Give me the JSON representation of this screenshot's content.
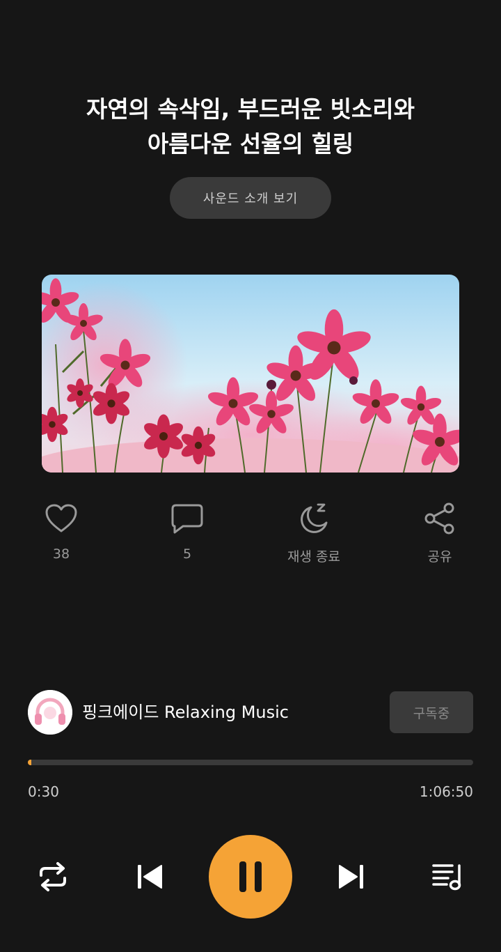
{
  "header": {
    "title_line1": "자연의 속삭임, 부드러운 빗소리와",
    "title_line2": "아름다운 선율의 힐링",
    "intro_button": "사운드 소개 보기"
  },
  "artwork": {
    "description_icon": "pink-cosmos-flowers-image"
  },
  "actions": {
    "like": {
      "icon": "heart-icon",
      "label": "38"
    },
    "comment": {
      "icon": "speech-bubble-icon",
      "label": "5"
    },
    "sleep_timer": {
      "icon": "moon-zzz-icon",
      "label": "재생 종료"
    },
    "share": {
      "icon": "share-icon",
      "label": "공유"
    }
  },
  "channel": {
    "name": "핑크에이드 Relaxing Music",
    "subscribe_label": "구독중"
  },
  "player": {
    "current_time": "0:30",
    "total_time": "1:06:50",
    "progress_fraction": 0.0075
  },
  "controls": {
    "repeat": "repeat-icon",
    "previous": "skip-previous-icon",
    "play_pause": "pause-icon",
    "next": "skip-next-icon",
    "playlist": "playlist-icon"
  },
  "colors": {
    "background": "#161616",
    "accent": "#f5a336",
    "button_bg": "#3a3a3a"
  }
}
